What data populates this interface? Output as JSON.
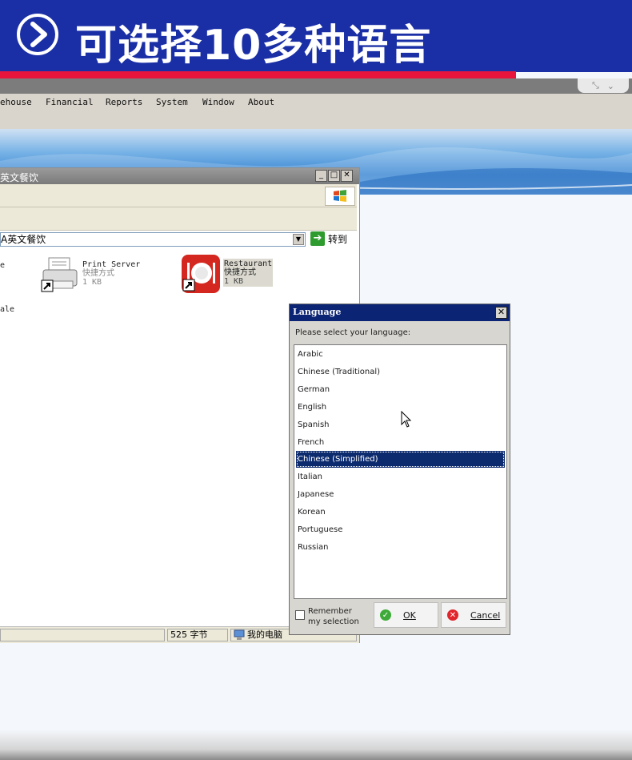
{
  "banner": {
    "title": "可选择10多种语言",
    "accent_color": "#1a2fa6",
    "stripe_color": "#e8143c",
    "icon": "play-arrow-circle-icon"
  },
  "app": {
    "menu": [
      "ehouse",
      "Financial",
      "Reports",
      "System",
      "Window",
      "About"
    ],
    "window_control_icons": [
      "restore-icon",
      "chevron-down-icon"
    ]
  },
  "explorer": {
    "title": "英文餐饮",
    "address": "A英文餐饮",
    "go_label": "转到",
    "left_items": [
      "e",
      "ale"
    ],
    "files": [
      {
        "name": "Print Server",
        "type": "快捷方式",
        "size": "1 KB",
        "icon": "printer-shortcut-icon"
      },
      {
        "name": "Restaurant",
        "type": "快捷方式",
        "size": "1 KB",
        "icon": "restaurant-plate-icon"
      }
    ],
    "status": {
      "bytes": "525 字节",
      "location": "我的电脑"
    }
  },
  "dialog": {
    "title": "Language",
    "prompt": "Please select your language:",
    "languages": [
      "Arabic",
      "Chinese (Traditional)",
      "German",
      "English",
      "Spanish",
      "French",
      "Chinese (Simplified)",
      "Italian",
      "Japanese",
      "Korean",
      "Portuguese",
      "Russian"
    ],
    "selected": "Chinese (Simplified)",
    "remember_label": "Remember my selection",
    "remember_checked": false,
    "ok_label": "OK",
    "cancel_label": "Cancel",
    "selection_color": "#0c2a6e"
  }
}
